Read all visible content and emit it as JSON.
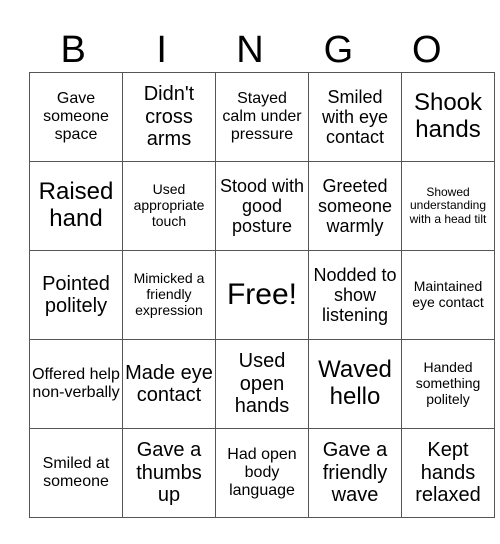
{
  "header": {
    "letters": [
      "B",
      "I",
      "N",
      "G",
      "O"
    ]
  },
  "grid": {
    "rows": [
      [
        "Gave someone space",
        "Didn't cross arms",
        "Stayed calm under pressure",
        "Smiled with eye contact",
        "Shook hands"
      ],
      [
        "Raised hand",
        "Used appropriate touch",
        "Stood with good posture",
        "Greeted someone warmly",
        "Showed understanding with a head tilt"
      ],
      [
        "Pointed politely",
        "Mimicked a friendly expression",
        "Free!",
        "Nodded to show listening",
        "Maintained eye contact"
      ],
      [
        "Offered help non-verbally",
        "Made eye contact",
        "Used open hands",
        "Waved hello",
        "Handed something politely"
      ],
      [
        "Smiled at someone",
        "Gave a thumbs up",
        "Had open body language",
        "Gave a friendly wave",
        "Kept hands relaxed"
      ]
    ]
  }
}
